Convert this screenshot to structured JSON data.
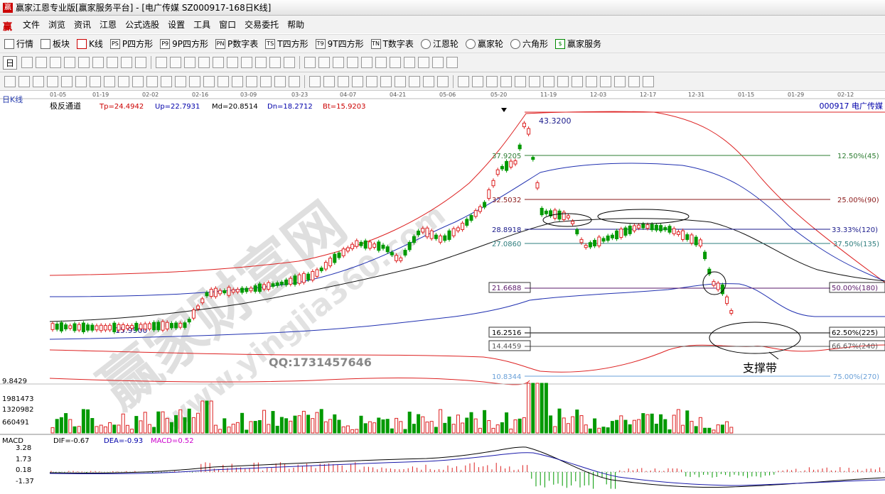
{
  "window": {
    "title": "赢家江恩专业版[赢家服务平台] - [电广传媒  SZ000917-168日K线]",
    "logo": "赢"
  },
  "menu": {
    "items": [
      "文件",
      "浏览",
      "资讯",
      "江恩",
      "公式选股",
      "设置",
      "工具",
      "窗口",
      "交易委托",
      "帮助"
    ]
  },
  "toolbar1": {
    "items": [
      {
        "icon": "grid-icon",
        "label": "行情"
      },
      {
        "icon": "board-icon",
        "label": "板块"
      },
      {
        "icon": "kline-icon",
        "label": "K线"
      },
      {
        "icon": "ps-icon",
        "label": "P四方形",
        "badge": "PS"
      },
      {
        "icon": "p9-icon",
        "label": "9P四方形",
        "badge": "P9"
      },
      {
        "icon": "pn-icon",
        "label": "P数字表",
        "badge": "PN"
      },
      {
        "icon": "ts-icon",
        "label": "T四方形",
        "badge": "TS"
      },
      {
        "icon": "t9-icon",
        "label": "9T四方形",
        "badge": "T9"
      },
      {
        "icon": "tn-icon",
        "label": "T数字表",
        "badge": "TN"
      },
      {
        "icon": "wheel-icon",
        "label": "江恩轮"
      },
      {
        "icon": "winner-wheel-icon",
        "label": "赢家轮"
      },
      {
        "icon": "star-icon",
        "label": "六角形"
      },
      {
        "icon": "dollar-icon",
        "label": "赢家服务"
      }
    ]
  },
  "toolbar2": {
    "period": "日"
  },
  "chart": {
    "panel_label": "日K线",
    "indicator_name": "极反通道",
    "tp": "Tp=24.4942",
    "up": "Up=22.7931",
    "md": "Md=20.8514",
    "dn": "Dn=18.2712",
    "bt": "Bt=15.9203",
    "stock": "000917 电广传媒",
    "dates": [
      "01-05",
      "01-19",
      "02-02",
      "02-16",
      "03-09",
      "03-23",
      "04-07",
      "04-21",
      "05-06",
      "05-20",
      "11-19",
      "12-03",
      "12-17",
      "12-31",
      "01-15",
      "01-29",
      "02-12"
    ],
    "high_label": "43.3200",
    "low_label": "15.9900",
    "level_left": "9.8429",
    "fib_left": [
      "37.9205",
      "32.5032",
      "28.8918",
      "27.0860",
      "21.6688",
      "16.2516",
      "14.4459",
      "10.8344"
    ],
    "fib_right": [
      "12.50%(45)",
      "25.00%(90)",
      "33.33%(120)",
      "37.50%(135)",
      "50.00%(180)",
      "62.50%(225)",
      "66.67%(240)",
      "75.00%(270)"
    ],
    "fib_colors": [
      "#2e7d32",
      "#8b1a1a",
      "#1a1a8b",
      "#2e7d7d",
      "#5a1a6a",
      "#000000",
      "#555555",
      "#6aa0d8"
    ],
    "qq": "QQ:1731457646",
    "annotation": "支撑带",
    "watermark": "赢家财富网",
    "watermark_url": "www.yingjia360.com",
    "vol_labels": [
      "1981473",
      "1320982",
      "660491"
    ],
    "macd_name": "MACD",
    "dif": "DIF=-0.67",
    "dea": "DEA=-0.93",
    "macd": "MACD=0.52",
    "macd_labels": [
      "3.28",
      "1.73",
      "0.18",
      "-1.37"
    ]
  }
}
